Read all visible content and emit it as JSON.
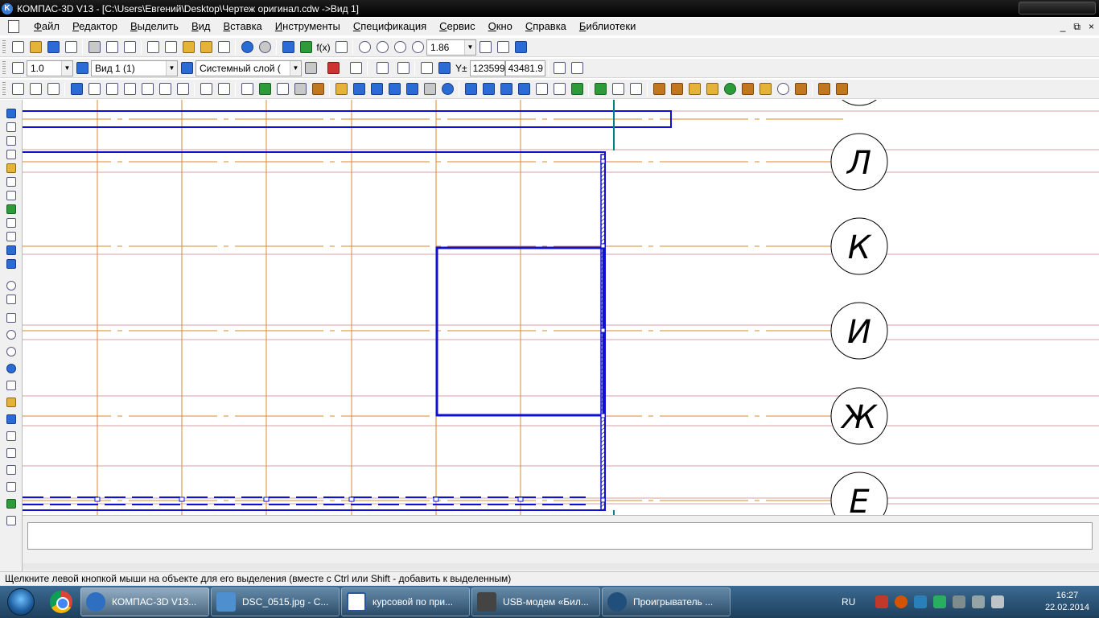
{
  "window": {
    "title": "КОМПАС-3D V13 - [C:\\Users\\Евгений\\Desktop\\Чертеж оригинал.cdw ->Вид 1]",
    "app_icon_letter": "K"
  },
  "menu": {
    "items": [
      "Файл",
      "Редактор",
      "Выделить",
      "Вид",
      "Вставка",
      "Инструменты",
      "Спецификация",
      "Сервис",
      "Окно",
      "Справка",
      "Библиотеки"
    ],
    "mdi_controls": [
      "_",
      "⧉",
      "×"
    ]
  },
  "toolbar_standard": {
    "zoom_value": "1.86",
    "fx_label": "f(x)"
  },
  "toolbar_current_state": {
    "step_value": "1.0",
    "view_value": "Вид 1 (1)",
    "layer_value": "Системный слой (",
    "coord_x": "123599",
    "coord_y": "43481.9",
    "coord_label": "Y±"
  },
  "drawing": {
    "axis_labels": [
      "Л",
      "К",
      "И",
      "Ж",
      "Е"
    ],
    "colors": {
      "contour": "#1010d0",
      "axis": "#d98a2b",
      "thin": "#c98080",
      "accent": "#008080"
    }
  },
  "status_bar": {
    "text": "Щелкните левой кнопкой мыши на объекте для его выделения (вместе с Ctrl или Shift - добавить к выделенным)"
  },
  "taskbar": {
    "tasks": [
      {
        "label": "КОМПАС-3D V13...",
        "icon": "kompas-icon",
        "active": true
      },
      {
        "label": "DSC_0515.jpg - С...",
        "icon": "image-viewer-icon",
        "active": false
      },
      {
        "label": "курсовой по при...",
        "icon": "word-icon",
        "active": false
      },
      {
        "label": "USB-модем «Бил...",
        "icon": "modem-icon",
        "active": false
      },
      {
        "label": "Проигрыватель ...",
        "icon": "media-player-icon",
        "active": false
      }
    ],
    "language": "RU",
    "time": "16:27",
    "date": "22.02.2014"
  }
}
